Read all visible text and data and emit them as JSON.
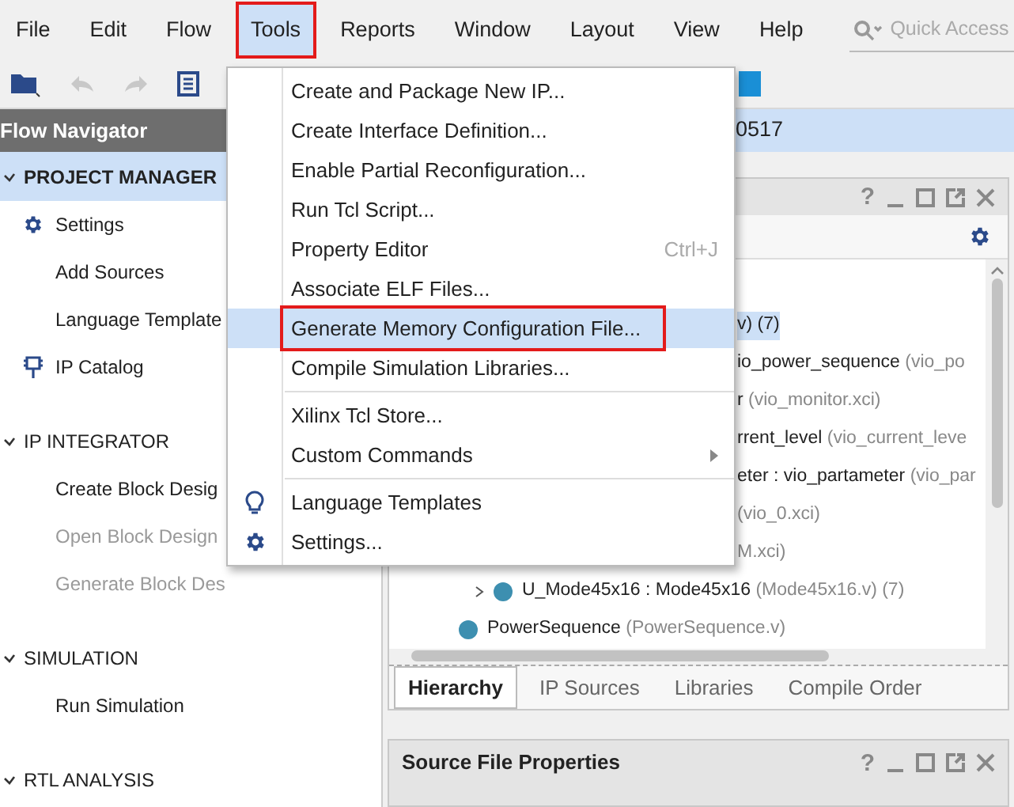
{
  "menubar": {
    "items": [
      {
        "label": "File",
        "selected": false,
        "annotated": false
      },
      {
        "label": "Edit",
        "selected": false,
        "annotated": false
      },
      {
        "label": "Flow",
        "selected": false,
        "annotated": false
      },
      {
        "label": "Tools",
        "selected": true,
        "annotated": true
      },
      {
        "label": "Reports",
        "selected": false,
        "annotated": false
      },
      {
        "label": "Window",
        "selected": false,
        "annotated": false
      },
      {
        "label": "Layout",
        "selected": false,
        "annotated": false
      },
      {
        "label": "View",
        "selected": false,
        "annotated": false
      },
      {
        "label": "Help",
        "selected": false,
        "annotated": false
      }
    ],
    "search": {
      "placeholder": "Quick Access"
    }
  },
  "flow_navigator": {
    "title": "Flow Navigator",
    "sections": [
      {
        "title": "PROJECT MANAGER",
        "selected": true,
        "expanded": true,
        "items": [
          {
            "label": "Settings",
            "kind": "settings",
            "disabled": false
          },
          {
            "label": "Add Sources",
            "kind": "plain",
            "disabled": false
          },
          {
            "label": "Language Template",
            "kind": "plain",
            "disabled": false
          },
          {
            "label": "IP Catalog",
            "kind": "catalog",
            "disabled": false
          }
        ]
      },
      {
        "title": "IP INTEGRATOR",
        "selected": false,
        "expanded": true,
        "items": [
          {
            "label": "Create Block Desig",
            "kind": "plain",
            "disabled": false
          },
          {
            "label": "Open Block Design",
            "kind": "plain",
            "disabled": true
          },
          {
            "label": "Generate Block Des",
            "kind": "plain",
            "disabled": true
          }
        ]
      },
      {
        "title": "SIMULATION",
        "selected": false,
        "expanded": true,
        "items": [
          {
            "label": "Run Simulation",
            "kind": "plain",
            "disabled": false
          }
        ]
      },
      {
        "title": "RTL ANALYSIS",
        "selected": false,
        "expanded": true
      }
    ]
  },
  "project_bar": {
    "text": "0517"
  },
  "sources": {
    "rows": [
      {
        "kind": "clipped",
        "name": "v) (7)",
        "selected": true
      },
      {
        "kind": "clipped",
        "name": "io_power_sequence",
        "detail": "(vio_po",
        "selected": false
      },
      {
        "kind": "clipped",
        "name": "r",
        "detail": "(vio_monitor.xci)",
        "selected": false
      },
      {
        "kind": "clipped",
        "name": "rrent_level",
        "detail": "(vio_current_leve",
        "selected": false
      },
      {
        "kind": "clipped",
        "name": "eter : vio_partameter",
        "detail": "(vio_par",
        "selected": false
      },
      {
        "kind": "clipped",
        "detail": "(vio_0.xci)",
        "selected": false
      },
      {
        "kind": "clipped",
        "detail": "M.xci)",
        "selected": false
      },
      {
        "kind": "module",
        "name": "U_Mode45x16 : Mode45x16",
        "detail": "(Mode45x16.v) (7)",
        "selected": false
      },
      {
        "kind": "file",
        "name": "PowerSequence",
        "detail": "(PowerSequence.v)",
        "selected": false
      }
    ],
    "tabs": [
      {
        "label": "Hierarchy",
        "selected": true
      },
      {
        "label": "IP Sources",
        "selected": false
      },
      {
        "label": "Libraries",
        "selected": false
      },
      {
        "label": "Compile Order",
        "selected": false
      }
    ]
  },
  "properties": {
    "title": "Source File Properties",
    "help": "?"
  },
  "sources_panel": {
    "help": "?"
  },
  "tools_menu": {
    "groups": [
      [
        {
          "label": "Create and Package New IP...",
          "kind": "plain",
          "selected": false,
          "annotated": false
        },
        {
          "label": "Create Interface Definition...",
          "kind": "plain",
          "selected": false,
          "annotated": false
        },
        {
          "label": "Enable Partial Reconfiguration...",
          "kind": "plain",
          "selected": false,
          "annotated": false
        },
        {
          "label": "Run Tcl Script...",
          "kind": "plain",
          "selected": false,
          "annotated": false
        },
        {
          "label": "Property Editor",
          "shortcut": "Ctrl+J",
          "kind": "plain",
          "selected": false,
          "annotated": false
        },
        {
          "label": "Associate ELF Files...",
          "kind": "plain",
          "selected": false,
          "annotated": false
        },
        {
          "label": "Generate Memory Configuration File...",
          "kind": "plain",
          "selected": true,
          "annotated": true
        },
        {
          "label": "Compile Simulation Libraries...",
          "kind": "plain",
          "selected": false,
          "annotated": false
        }
      ],
      [
        {
          "label": "Xilinx Tcl Store...",
          "kind": "plain",
          "selected": false,
          "annotated": false
        },
        {
          "label": "Custom Commands",
          "kind": "submenu",
          "selected": false,
          "annotated": false
        }
      ],
      [
        {
          "label": "Language Templates",
          "kind": "hint",
          "selected": false,
          "annotated": false
        },
        {
          "label": "Settings...",
          "kind": "settings",
          "selected": false,
          "annotated": false
        }
      ]
    ]
  }
}
